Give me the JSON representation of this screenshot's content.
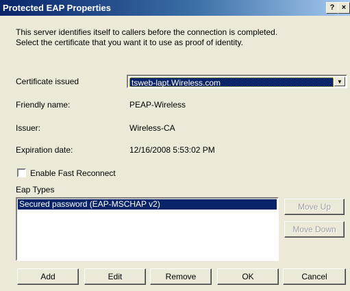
{
  "window": {
    "title": "Protected EAP Properties",
    "help_button": "?",
    "close_button": "×"
  },
  "intro": {
    "line1": "This server identifies itself to callers before the connection is completed.",
    "line2": "Select the certificate that you want it to use as proof of identity."
  },
  "fields": {
    "certificate_label": "Certificate issued",
    "certificate_value": "tsweb-lapt.Wireless.com",
    "friendly_label": "Friendly name:",
    "friendly_value": "PEAP-Wireless",
    "issuer_label": "Issuer:",
    "issuer_value": "Wireless-CA",
    "expiration_label": "Expiration date:",
    "expiration_value": "12/16/2008 5:53:02 PM"
  },
  "fast_reconnect": {
    "label": "Enable Fast Reconnect",
    "checked": false
  },
  "eap": {
    "label": "Eap Types",
    "items": [
      "Secured password (EAP-MSCHAP v2)"
    ],
    "move_up": "Move Up",
    "move_down": "Move Down"
  },
  "buttons": {
    "add": "Add",
    "edit": "Edit",
    "remove": "Remove",
    "ok": "OK",
    "cancel": "Cancel"
  }
}
